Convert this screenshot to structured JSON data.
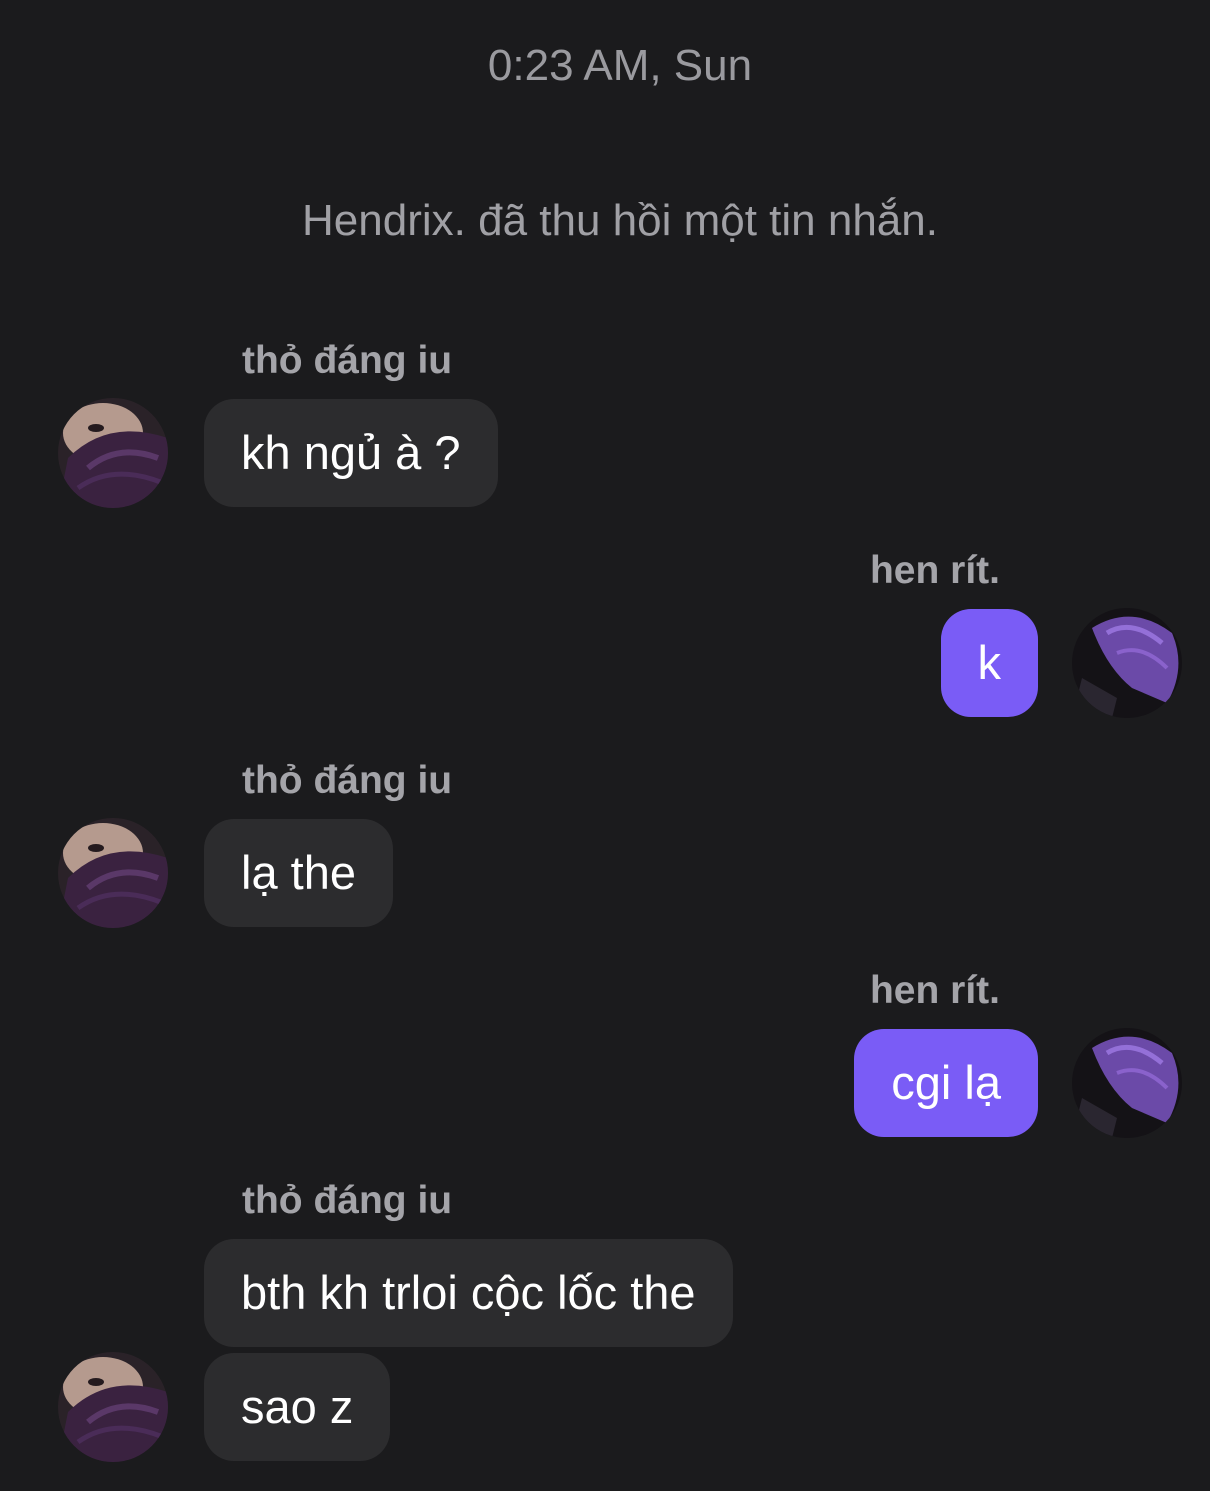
{
  "conversation": {
    "timestamp": "0:23 AM, Sun",
    "system_note": "Hendrix. đã thu hồi một tin nhắn.",
    "messages": [
      {
        "sender": "thỏ đáng iu",
        "text": "kh ngủ à ?"
      },
      {
        "sender": "hen rít.",
        "text": "k"
      },
      {
        "sender": "thỏ đáng iu",
        "text": "lạ the"
      },
      {
        "sender": "hen rít.",
        "text": "cgi lạ"
      },
      {
        "sender": "thỏ đáng iu",
        "text": "bth kh trloi cộc lốc the"
      },
      {
        "sender": "",
        "text": "sao z"
      }
    ]
  },
  "colors": {
    "background": "#1b1b1d",
    "incoming_bubble": "#2c2c2e",
    "outgoing_bubble": "#7a5cf6",
    "meta_text": "#9a9a9f"
  }
}
